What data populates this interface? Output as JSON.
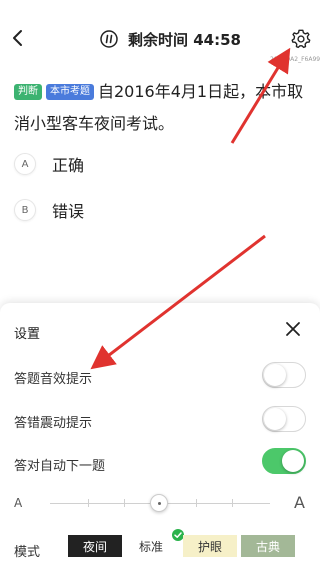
{
  "header": {
    "timer_label": "剩余时间 44:58",
    "question_id": "20ASOA2_F6A99"
  },
  "question": {
    "tags": [
      "判断",
      "本市考题"
    ],
    "text": "自2016年4月1日起，本市取消小型客车夜间考试。"
  },
  "options": [
    {
      "letter": "A",
      "text": "正确"
    },
    {
      "letter": "B",
      "text": "错误"
    }
  ],
  "settings": {
    "title": "设置",
    "rows": [
      {
        "label": "答题音效提示",
        "on": false
      },
      {
        "label": "答错震动提示",
        "on": false
      },
      {
        "label": "答对自动下一题",
        "on": true
      }
    ],
    "font_small": "A",
    "font_large": "A",
    "font_level": 0.5,
    "mode_label": "模式",
    "modes": [
      "夜间",
      "标准",
      "护眼",
      "古典"
    ],
    "selected_mode": "标准"
  },
  "colors": {
    "toggle_on": "#4cc86a",
    "annotation_arrow": "#e0332f",
    "tag_green": "#3cb371",
    "tag_blue": "#4a7bdc"
  },
  "icons": [
    "back-icon",
    "pause-icon",
    "gear-icon",
    "close-icon",
    "check-icon"
  ]
}
